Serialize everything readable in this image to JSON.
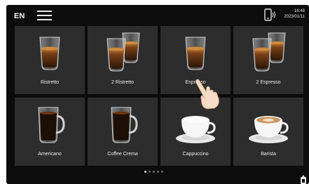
{
  "header": {
    "language": "EN",
    "time": "16:48",
    "date": "2023/01/11"
  },
  "icons": {
    "menu": "hamburger-menu-icon",
    "phone": "smartphone-connect-icon",
    "water": "hot-water-icon"
  },
  "drinks": [
    {
      "label": "Ristretto",
      "icon": "single-glass-cup-icon"
    },
    {
      "label": "2 Ristretto",
      "icon": "double-glass-cup-icon"
    },
    {
      "label": "Espresso",
      "icon": "single-glass-cup-icon"
    },
    {
      "label": "2 Espresso",
      "icon": "double-glass-cup-icon"
    },
    {
      "label": "Americano",
      "icon": "glass-mug-icon"
    },
    {
      "label": "Coffee Crema",
      "icon": "glass-mug-icon"
    },
    {
      "label": "Cappuccino",
      "icon": "cup-saucer-icon"
    },
    {
      "label": "Barista",
      "icon": "cup-saucer-icon"
    }
  ],
  "pagination": {
    "pages": 5,
    "current": 1
  },
  "colors": {
    "screen": "#0c0c0c",
    "tile": "#2d2d2d",
    "text": "#ececec",
    "coffee": "#3a200e",
    "crema": "#b8722c"
  }
}
